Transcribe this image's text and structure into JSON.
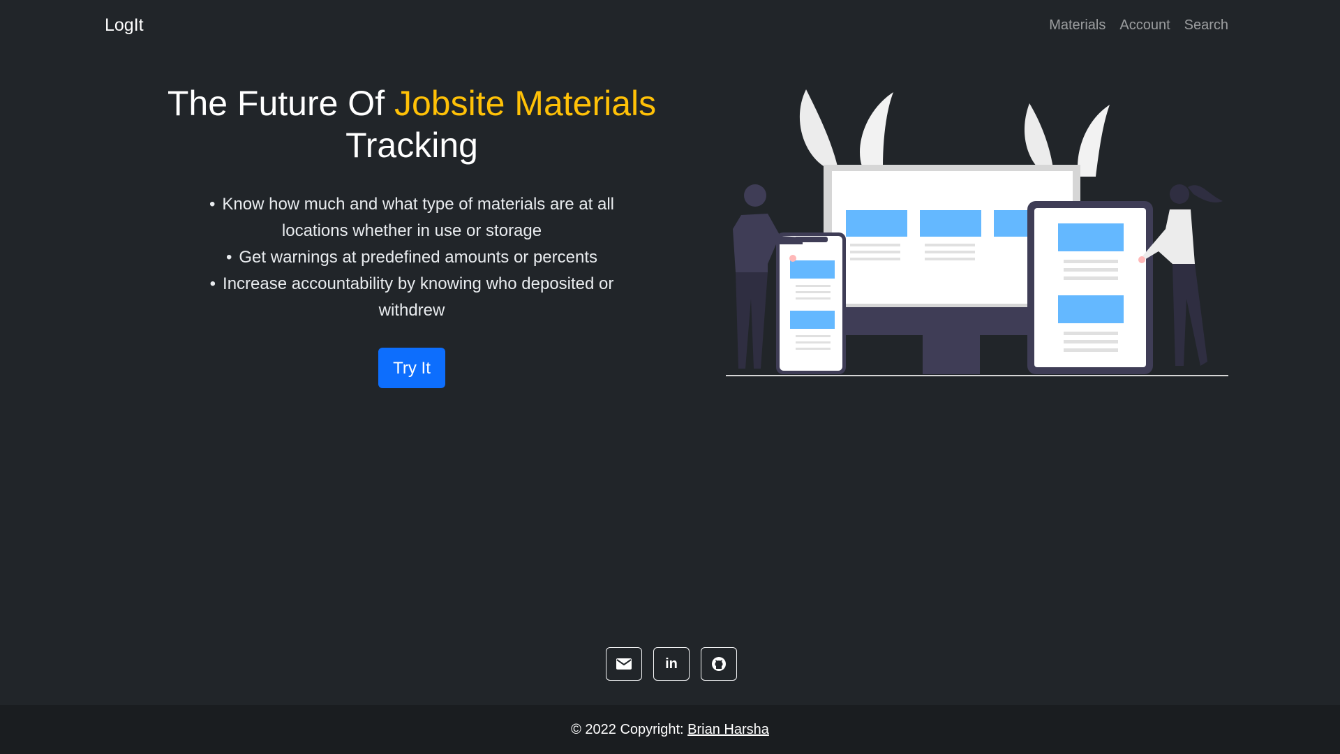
{
  "nav": {
    "brand": "LogIt",
    "links": [
      "Materials",
      "Account",
      "Search"
    ]
  },
  "hero": {
    "title_part1": "The Future Of ",
    "title_accent": "Jobsite Materials",
    "title_part2": "Tracking",
    "features": [
      "Know how much and what type of materials are at all locations whether in use or storage",
      "Get warnings at predefined amounts or percents",
      "Increase accountability by knowing who deposited or withdrew"
    ],
    "cta_label": "Try It"
  },
  "socials": [
    {
      "icon": "envelope-icon"
    },
    {
      "icon": "linkedin-icon"
    },
    {
      "icon": "github-icon"
    }
  ],
  "footer": {
    "copyright": "© 2022 Copyright: ",
    "author": "Brian Harsha"
  },
  "colors": {
    "background": "#212529",
    "footer_background": "#1a1d20",
    "accent": "#ffc107",
    "primary": "#0d6efd",
    "illustration_blue": "#64b8ff"
  }
}
